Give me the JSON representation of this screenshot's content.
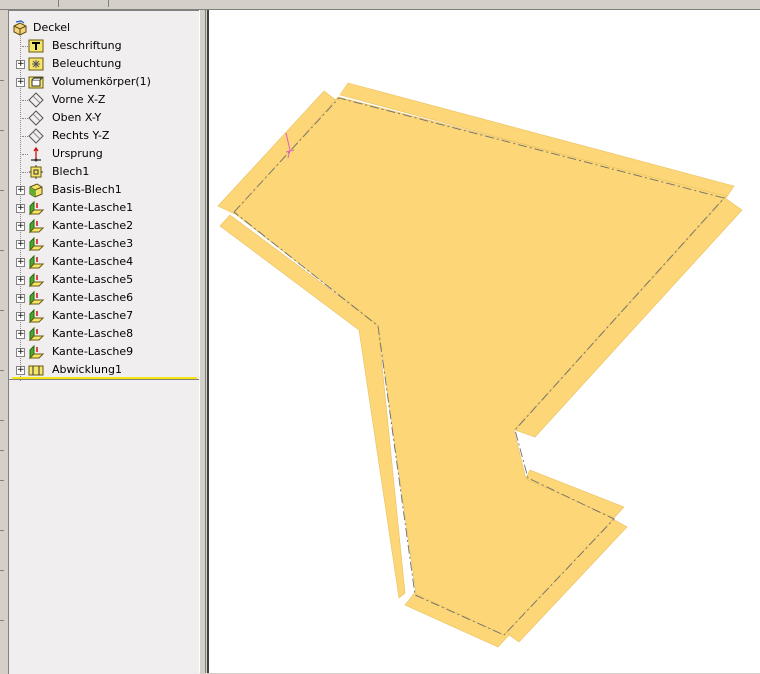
{
  "window": {
    "tab_labels": [
      "",
      ""
    ]
  },
  "feature_tree": {
    "root": {
      "label": "Deckel",
      "icon": "part-icon"
    },
    "items": [
      {
        "label": "Beschriftung",
        "icon": "annotation-text-icon",
        "expandable": false
      },
      {
        "label": "Beleuchtung",
        "icon": "lighting-icon",
        "expandable": true
      },
      {
        "label": "Volumenkörper(1)",
        "icon": "solid-bodies-folder-icon",
        "expandable": true
      },
      {
        "label": "Vorne X-Z",
        "icon": "plane-icon",
        "expandable": false
      },
      {
        "label": "Oben X-Y",
        "icon": "plane-icon",
        "expandable": false
      },
      {
        "label": "Rechts Y-Z",
        "icon": "plane-icon",
        "expandable": false
      },
      {
        "label": "Ursprung",
        "icon": "origin-icon",
        "expandable": false
      },
      {
        "label": "Blech1",
        "icon": "sheet-metal-icon",
        "expandable": false
      },
      {
        "label": "Basis-Blech1",
        "icon": "base-flange-icon",
        "expandable": true
      },
      {
        "label": "Kante-Lasche1",
        "icon": "edge-flange-icon",
        "expandable": true
      },
      {
        "label": "Kante-Lasche2",
        "icon": "edge-flange-icon",
        "expandable": true
      },
      {
        "label": "Kante-Lasche3",
        "icon": "edge-flange-icon",
        "expandable": true
      },
      {
        "label": "Kante-Lasche4",
        "icon": "edge-flange-icon",
        "expandable": true
      },
      {
        "label": "Kante-Lasche5",
        "icon": "edge-flange-icon",
        "expandable": true
      },
      {
        "label": "Kante-Lasche6",
        "icon": "edge-flange-icon",
        "expandable": true
      },
      {
        "label": "Kante-Lasche7",
        "icon": "edge-flange-icon",
        "expandable": true
      },
      {
        "label": "Kante-Lasche8",
        "icon": "edge-flange-icon",
        "expandable": true
      },
      {
        "label": "Kante-Lasche9",
        "icon": "edge-flange-icon",
        "expandable": true
      },
      {
        "label": "Abwicklung1",
        "icon": "flat-pattern-icon",
        "expandable": true
      }
    ],
    "rollback_bar_color": "#f5e50e"
  },
  "graphics_area": {
    "flat_pattern_fill": "#fcd677",
    "bend_line_color": "#707070",
    "background": "#ffffff"
  }
}
